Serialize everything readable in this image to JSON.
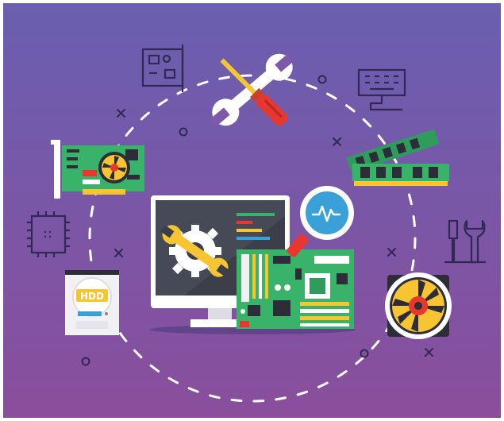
{
  "illustration": {
    "colors": {
      "bg_top": "#6a5fb0",
      "bg_bottom": "#8a4e9c",
      "outline": "#34305c",
      "board_green": "#39b36a",
      "fan_yellow": "#f6c531",
      "fan_red": "#e8372f",
      "monitor_screen": "#3c3f4a",
      "accent_blue": "#3aa0d8"
    },
    "hdd_label": "HDD"
  }
}
